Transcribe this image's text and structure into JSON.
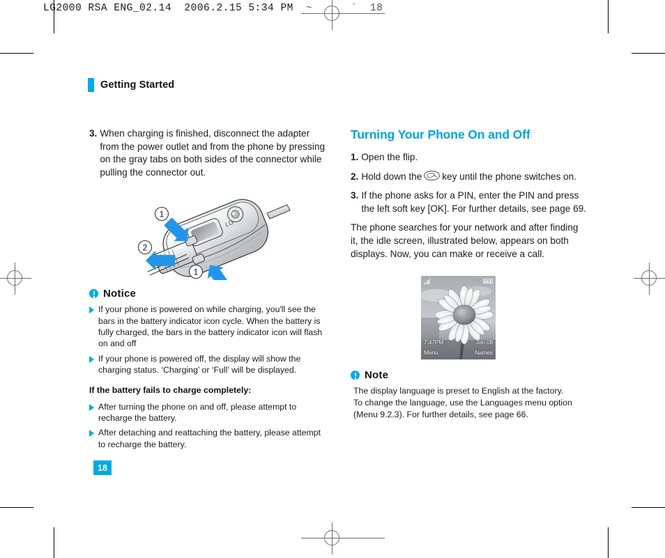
{
  "prepress": {
    "header_line": "LG2000 RSA ENG_02.14  2006.2.15 5:34 PM",
    "header_tail": "~      `  18"
  },
  "running_head": {
    "label": "Getting Started"
  },
  "left_column": {
    "step": {
      "num": "3.",
      "text": "When charging is finished, disconnect the adapter from the power outlet and from the phone by pressing on the gray tabs on both sides of the connector while pulling the connector out."
    },
    "illustration": {
      "callout_1": "1",
      "callout_2": "2",
      "callout_3": "1"
    },
    "notice": {
      "title": "Notice",
      "bullets": [
        "If your phone is powered on while charging, you'll see the bars in the battery indicator icon cycle. When the battery is fully charged, the bars in the battery indicator icon will flash on and off",
        "If your phone is powered off, the display will show the charging status. ‘Charging’ or ‘Full’ will be displayed."
      ]
    },
    "fail_section": {
      "title": "If the battery fails to charge completely:",
      "bullets": [
        "After turning the phone on and off, please attempt to recharge the battery.",
        "After detaching and reattaching the battery, please attempt to recharge the battery."
      ]
    }
  },
  "right_column": {
    "heading": "Turning Your Phone On and Off",
    "steps": [
      {
        "num": "1.",
        "text": "Open the flip.",
        "has_icon": false
      },
      {
        "num": "2.",
        "text_before": "Hold down the",
        "text_after": "key until the phone switches on.",
        "has_icon": true
      },
      {
        "num": "3.",
        "text": "If the phone asks for a PIN, enter the PIN and press the left soft key [OK]. For further details, see page 69.",
        "has_icon": false
      }
    ],
    "paragraph": "The phone searches for your network and after finding it, the idle screen, illustrated below, appears on both displays. Now, you can make or receive a call.",
    "idle_screen": {
      "time": "7:47PM",
      "date": "Jan 08",
      "left_soft_key": "Menu",
      "right_soft_key": "Names",
      "music_icon": "♪"
    },
    "note": {
      "title": "Note",
      "lines": [
        "The display language is preset to English at the factory.",
        "To change the language, use the Languages menu option",
        "(Menu 9.2.3). For further details, see page 66."
      ]
    }
  },
  "page_number": "18",
  "colors": {
    "accent": "#00a9e5",
    "heading_blue": "#00a3e0"
  }
}
